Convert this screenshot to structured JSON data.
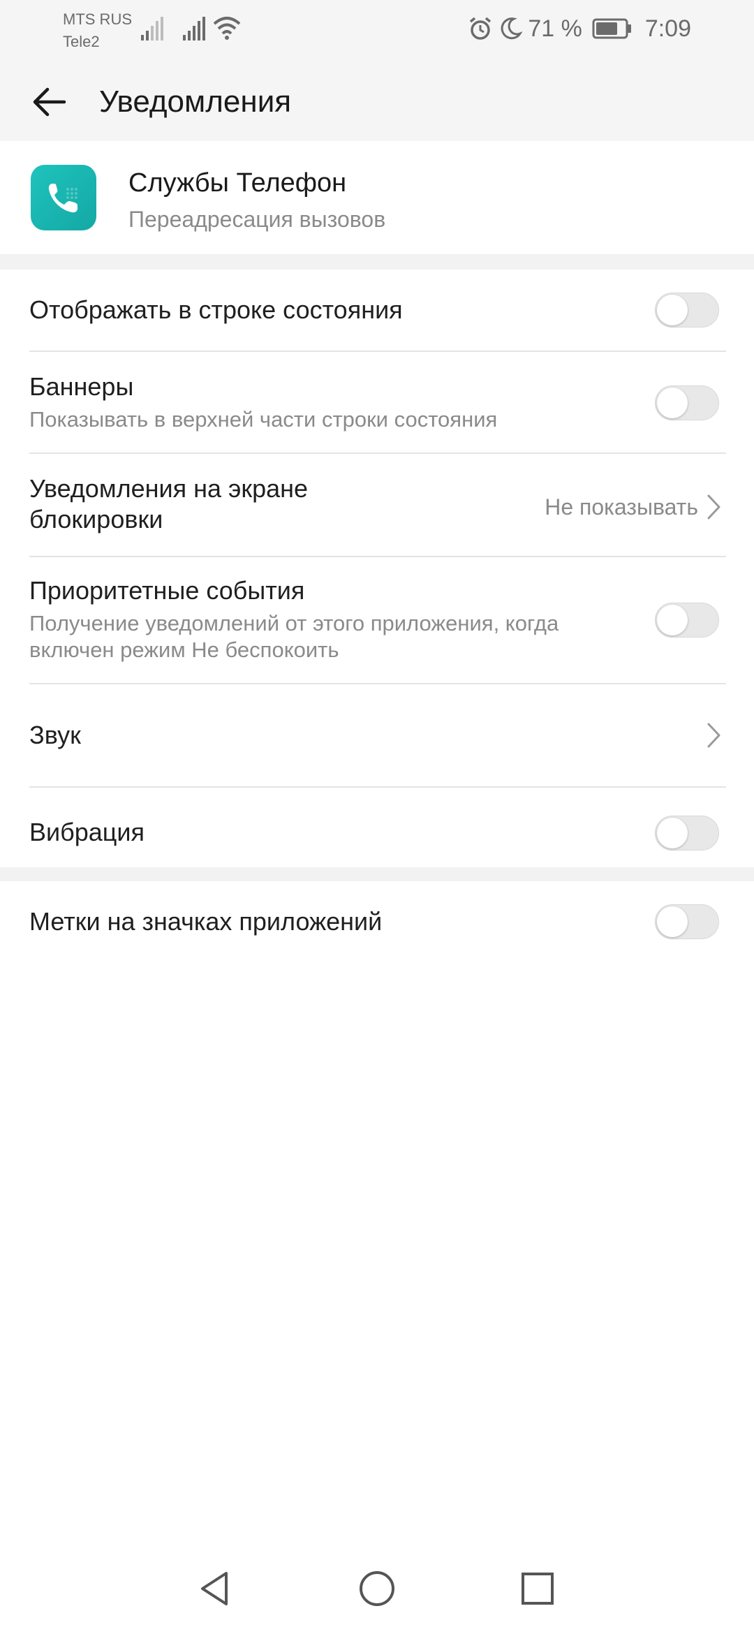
{
  "status_bar": {
    "carrier1": "MTS RUS",
    "carrier2": "Tele2",
    "battery_percent": "71 %",
    "time": "7:09",
    "icons": [
      "signal-icon",
      "signal-icon",
      "wifi-icon",
      "alarm-icon",
      "moon-icon",
      "battery-icon"
    ]
  },
  "header": {
    "title": "Уведомления",
    "back_icon": "arrow-left-icon"
  },
  "app": {
    "name": "Службы Телефон",
    "subtitle": "Переадресация вызовов",
    "icon": "phone-icon",
    "icon_color": "#1fc3bd"
  },
  "settings": {
    "status_bar": {
      "title": "Отображать в строке состояния",
      "enabled": false
    },
    "banners": {
      "title": "Баннеры",
      "desc": "Показывать в верхней части строки состояния",
      "enabled": false
    },
    "lockscreen": {
      "title_line1": "Уведомления на экране",
      "title_line2": "блокировки",
      "value": "Не показывать"
    },
    "priority": {
      "title": "Приоритетные события",
      "desc_line1": "Получение уведомлений от этого приложения, когда",
      "desc_line2": "включен режим Не беспокоить",
      "enabled": false
    },
    "sound": {
      "title": "Звук"
    },
    "vibration": {
      "title": "Вибрация",
      "enabled": false
    },
    "badges": {
      "title": "Метки на значках приложений",
      "enabled": false
    }
  },
  "nav": {
    "back": "triangle-back-icon",
    "home": "circle-home-icon",
    "recents": "square-recents-icon"
  }
}
